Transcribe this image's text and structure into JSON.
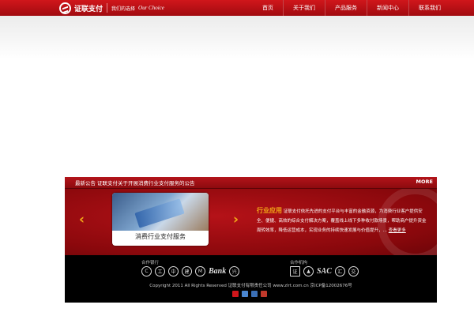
{
  "header": {
    "logo_name": "证联支付",
    "logo_slogan": "我们的选择",
    "logo_en": "Our Choice",
    "nav": [
      "首页",
      "关于我们",
      "产品服务",
      "新闻中心",
      "联系我们"
    ],
    "brand_color": "#c4151b"
  },
  "news": {
    "label": "最新公告",
    "headline": "证联支付关于开展消费行业支付服务的公告",
    "more": "MORE"
  },
  "feature": {
    "card_caption": "消费行业支付服务",
    "title": "行业应用",
    "body": "证联支付依托先进的支付平台与丰富的金融资源，为消费行业客户提供安全、便捷、高效的综合支付解决方案，覆盖线上线下多种收付款场景，帮助商户提升资金周转效率，降低运营成本，实现业务的持续快速发展与价值提升，",
    "more_link": "查看更多",
    "prev_arrow": "‹",
    "next_arrow": "›",
    "accent": "#f2a818"
  },
  "footer": {
    "partners_label": "合作银行",
    "partners_label2": "合作机构",
    "bank_icons": [
      "china-unionpay-icon",
      "icbc-icon",
      "boc-icon",
      "ccb-icon",
      "cmb-icon",
      "bank-icon",
      "cib-icon"
    ],
    "org_icons": [
      "csdc-icon",
      "org-icon",
      "sac-icon",
      "zhengzhou-icon",
      "sse-icon"
    ],
    "sac_text": "SAC",
    "bank_text": "Bank",
    "copyright": "Copyright 2011 All Rights Reserved 证联支付有限责任公司 www.zlrt.com.cn 京ICP备12002676号",
    "badge_colors": [
      "#d0161b",
      "#4a86d0",
      "#3b6fb5",
      "#c0392b"
    ]
  }
}
